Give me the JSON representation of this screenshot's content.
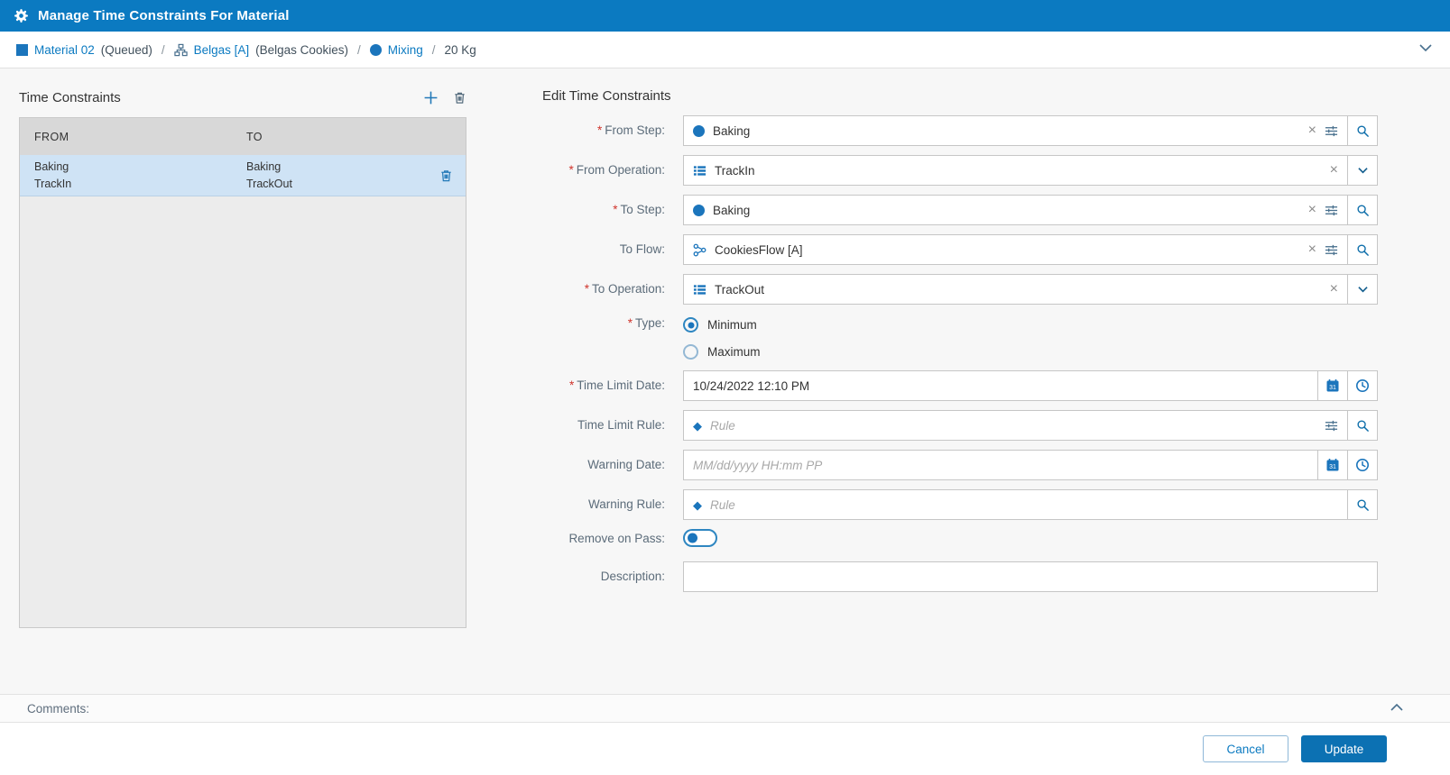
{
  "titlebar": {
    "title": "Manage Time Constraints For Material"
  },
  "breadcrumb": {
    "sep": "/",
    "material_label": "Material 02",
    "material_status": "(Queued)",
    "flow_label": "Belgas [A]",
    "flow_desc": "(Belgas Cookies)",
    "step_label": "Mixing",
    "quantity": "20 Kg"
  },
  "constraints_panel": {
    "title": "Time Constraints",
    "columns": {
      "from": "FROM",
      "to": "TO"
    },
    "rows": [
      {
        "from_step": "Baking",
        "from_op": "TrackIn",
        "to_step": "Baking",
        "to_op": "TrackOut"
      }
    ]
  },
  "edit_panel": {
    "title": "Edit Time Constraints",
    "required_marker": "*",
    "from_step": {
      "label": "From Step:",
      "value": "Baking",
      "required": true
    },
    "from_operation": {
      "label": "From Operation:",
      "value": "TrackIn",
      "required": true
    },
    "to_step": {
      "label": "To Step:",
      "value": "Baking",
      "required": true
    },
    "to_flow": {
      "label": "To Flow:",
      "value": "CookiesFlow [A]",
      "required": false
    },
    "to_operation": {
      "label": "To Operation:",
      "value": "TrackOut",
      "required": true
    },
    "type": {
      "label": "Type:",
      "required": true,
      "options": [
        {
          "label": "Minimum",
          "selected": true
        },
        {
          "label": "Maximum",
          "selected": false
        }
      ]
    },
    "time_limit_date": {
      "label": "Time Limit Date:",
      "value": "10/24/2022 12:10 PM",
      "required": true
    },
    "time_limit_rule": {
      "label": "Time Limit Rule:",
      "placeholder": "Rule",
      "required": false
    },
    "warning_date": {
      "label": "Warning Date:",
      "placeholder": "MM/dd/yyyy HH:mm PP",
      "required": false
    },
    "warning_rule": {
      "label": "Warning Rule:",
      "placeholder": "Rule",
      "required": false
    },
    "remove_on_pass": {
      "label": "Remove on Pass:",
      "value": false
    },
    "description": {
      "label": "Description:",
      "value": ""
    }
  },
  "comments": {
    "label": "Comments:"
  },
  "footer": {
    "cancel": "Cancel",
    "update": "Update"
  },
  "icons": {
    "clear_glyph": "×",
    "diamond_glyph": "◆"
  },
  "colors": {
    "accent": "#0b7ac1",
    "selected_row": "#cfe3f5",
    "required": "#d0342c",
    "update_button": "#0c71b3",
    "table_header": "#d8d8d8"
  }
}
